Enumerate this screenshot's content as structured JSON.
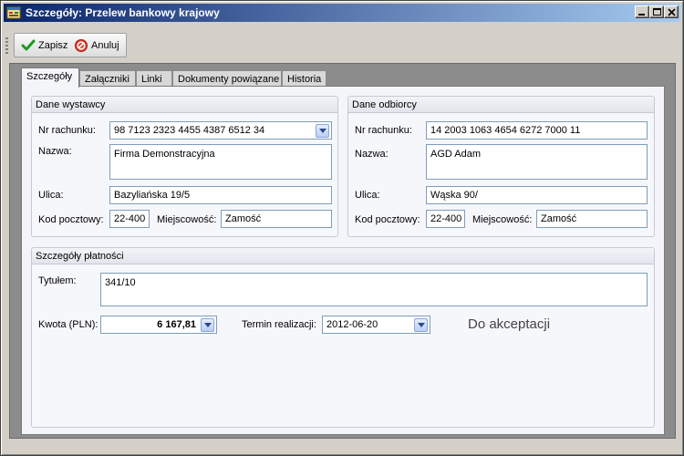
{
  "window": {
    "title": "Szczegóły: Przelew bankowy krajowy"
  },
  "toolbar": {
    "save_label": "Zapisz",
    "cancel_label": "Anuluj"
  },
  "tabs": [
    {
      "label": "Szczegóły",
      "active": true
    },
    {
      "label": "Załączniki",
      "active": false
    },
    {
      "label": "Linki",
      "active": false
    },
    {
      "label": "Dokumenty powiązane",
      "active": false
    },
    {
      "label": "Historia",
      "active": false
    }
  ],
  "issuer": {
    "title": "Dane wystawcy",
    "account_label": "Nr rachunku:",
    "account_value": "98 7123 2323 4455 4387 6512 34",
    "name_label": "Nazwa:",
    "name_value": "Firma Demonstracyjna",
    "street_label": "Ulica:",
    "street_value": "Bazyliańska 19/5",
    "postal_label": "Kod pocztowy:",
    "postal_value": "22-400",
    "city_label": "Miejscowość:",
    "city_value": "Zamość"
  },
  "recipient": {
    "title": "Dane odbiorcy",
    "account_label": "Nr rachunku:",
    "account_value": "14 2003 1063 4654 6272 7000 11",
    "name_label": "Nazwa:",
    "name_value": "AGD Adam",
    "street_label": "Ulica:",
    "street_value": "Wąska 90/",
    "postal_label": "Kod pocztowy:",
    "postal_value": "22-400",
    "city_label": "Miejscowość:",
    "city_value": "Zamość"
  },
  "payment": {
    "title": "Szczegóły płatności",
    "title_label": "Tytułem:",
    "title_value": "341/10",
    "amount_label": "Kwota (PLN):",
    "amount_value": "6 167,81",
    "due_label": "Termin realizacji:",
    "due_value": "2012-06-20",
    "status": "Do akceptacji"
  },
  "colors": {
    "titlebar_start": "#0a246a",
    "titlebar_end": "#a6caf0",
    "save_icon": "#1e9a1e",
    "cancel_icon": "#e03a2a"
  }
}
